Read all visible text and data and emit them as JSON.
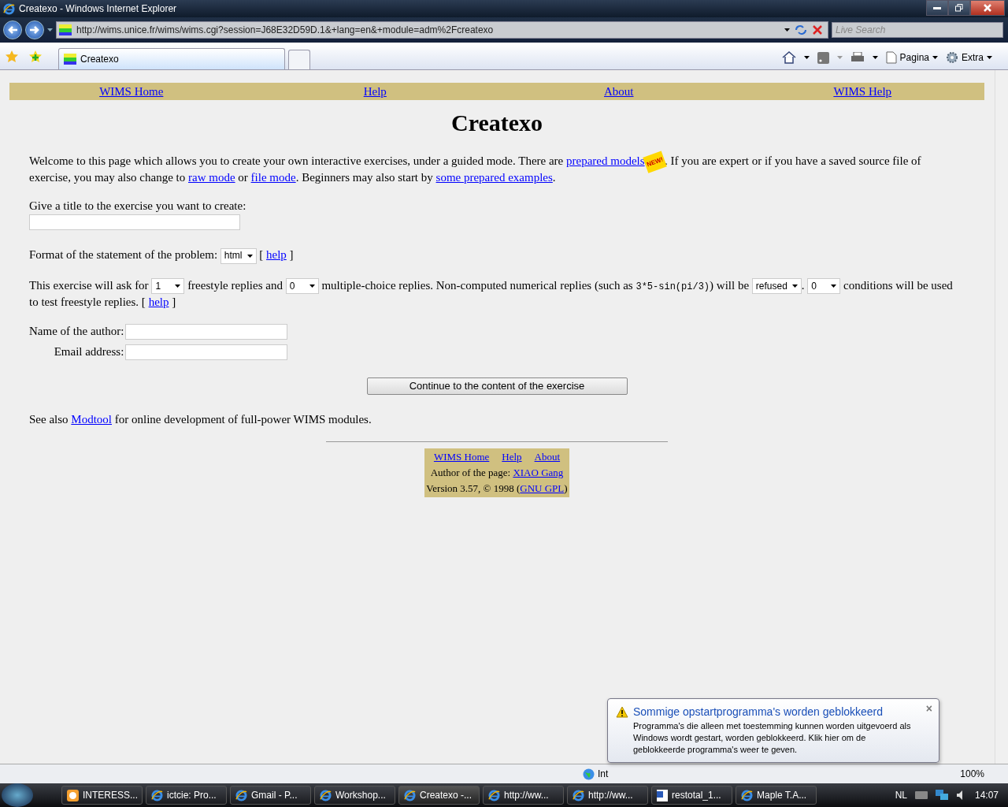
{
  "window": {
    "title": "Createxo - Windows Internet Explorer"
  },
  "address_bar": {
    "url": "http://wims.unice.fr/wims/wims.cgi?session=J68E32D59D.1&+lang=en&+module=adm%2Fcreatexo",
    "search_placeholder": "Live Search"
  },
  "tabs": [
    {
      "label": "Createxo",
      "selected": true
    }
  ],
  "command_bar": [
    "Pagina",
    "Extra"
  ],
  "page": {
    "top_nav": [
      "WIMS Home",
      "Help",
      "About",
      "WIMS Help"
    ],
    "heading": "Createxo",
    "intro": [
      {
        "kind": "text",
        "text": "Welcome to this page which allows you to create your own interactive exercises, under a guided mode. There are "
      },
      {
        "kind": "link",
        "text": "prepared models"
      },
      {
        "kind": "badge",
        "text": "NEW!"
      },
      {
        "kind": "text",
        "text": ". If you are expert or if you have a saved source file of exercise, you may also change to "
      },
      {
        "kind": "link",
        "text": "raw mode"
      },
      {
        "kind": "text",
        "text": " or "
      },
      {
        "kind": "link",
        "text": "file mode"
      },
      {
        "kind": "text",
        "text": ". Beginners may also start by "
      },
      {
        "kind": "link",
        "text": "some prepared examples"
      },
      {
        "kind": "text",
        "text": "."
      }
    ],
    "title_label": "Give a title to the exercise you want to create:",
    "format": [
      {
        "kind": "text",
        "text": "Format of the statement of the problem: "
      },
      {
        "kind": "select",
        "text": "html"
      },
      {
        "kind": "text",
        "text": " [ "
      },
      {
        "kind": "link",
        "text": "help"
      },
      {
        "kind": "text",
        "text": " ]"
      }
    ],
    "replies": [
      {
        "kind": "text",
        "text": "This exercise will ask for "
      },
      {
        "kind": "select",
        "text": "1"
      },
      {
        "kind": "text",
        "text": " freestyle replies and "
      },
      {
        "kind": "select",
        "text": "0"
      },
      {
        "kind": "text",
        "text": " multiple-choice replies. Non-computed numerical replies (such as "
      },
      {
        "kind": "code",
        "text": "3*5-sin(pi/3)"
      },
      {
        "kind": "text",
        "text": ") will be "
      },
      {
        "kind": "select",
        "text": "refused"
      },
      {
        "kind": "text",
        "text": ". "
      },
      {
        "kind": "select",
        "text": "0"
      },
      {
        "kind": "text",
        "text": " conditions will be used to test freestyle replies. [ "
      },
      {
        "kind": "link",
        "text": "help"
      },
      {
        "kind": "text",
        "text": " ]"
      }
    ],
    "fields": [
      {
        "label": "Name of the author:"
      },
      {
        "label": "Email address:"
      }
    ],
    "continue_button": "Continue to the content of the exercise",
    "see_also": [
      {
        "kind": "text",
        "text": "See also "
      },
      {
        "kind": "link",
        "text": "Modtool"
      },
      {
        "kind": "text",
        "text": " for online development of full-power WIMS modules."
      }
    ],
    "footer": {
      "links": [
        "WIMS Home",
        "Help",
        "About"
      ],
      "author": [
        {
          "kind": "text",
          "text": "Author of the page: "
        },
        {
          "kind": "link",
          "text": "XIAO Gang"
        }
      ],
      "version": [
        {
          "kind": "text",
          "text": "Version 3.57, © 1998 ("
        },
        {
          "kind": "link",
          "text": "GNU GPL"
        },
        {
          "kind": "text",
          "text": ")"
        }
      ]
    }
  },
  "status_bar": {
    "zone": "Int",
    "zoom": "100%"
  },
  "notification": {
    "title": "Sommige opstartprogramma's worden geblokkeerd",
    "body": "Programma's die alleen met toestemming kunnen worden uitgevoerd als Windows wordt gestart, worden geblokkeerd. Klik hier om de geblokkeerde programma's weer te geven.",
    "close": "×"
  },
  "taskbar": {
    "items": [
      {
        "label": "INTERESS...",
        "kind": "mail",
        "selected": false
      },
      {
        "label": "ictcie: Pro...",
        "kind": "browser",
        "selected": false
      },
      {
        "label": "Gmail - P...",
        "kind": "browser",
        "selected": false
      },
      {
        "label": "Workshop...",
        "kind": "browser",
        "selected": false
      },
      {
        "label": "Createxo -...",
        "kind": "browser",
        "selected": true
      },
      {
        "label": "http://ww...",
        "kind": "browser",
        "selected": false
      },
      {
        "label": "http://ww...",
        "kind": "browser",
        "selected": false
      },
      {
        "label": "restotal_1...",
        "kind": "document",
        "selected": false
      },
      {
        "label": "Maple T.A...",
        "kind": "browser",
        "selected": false
      }
    ],
    "language": "NL",
    "clock": "14:07"
  }
}
